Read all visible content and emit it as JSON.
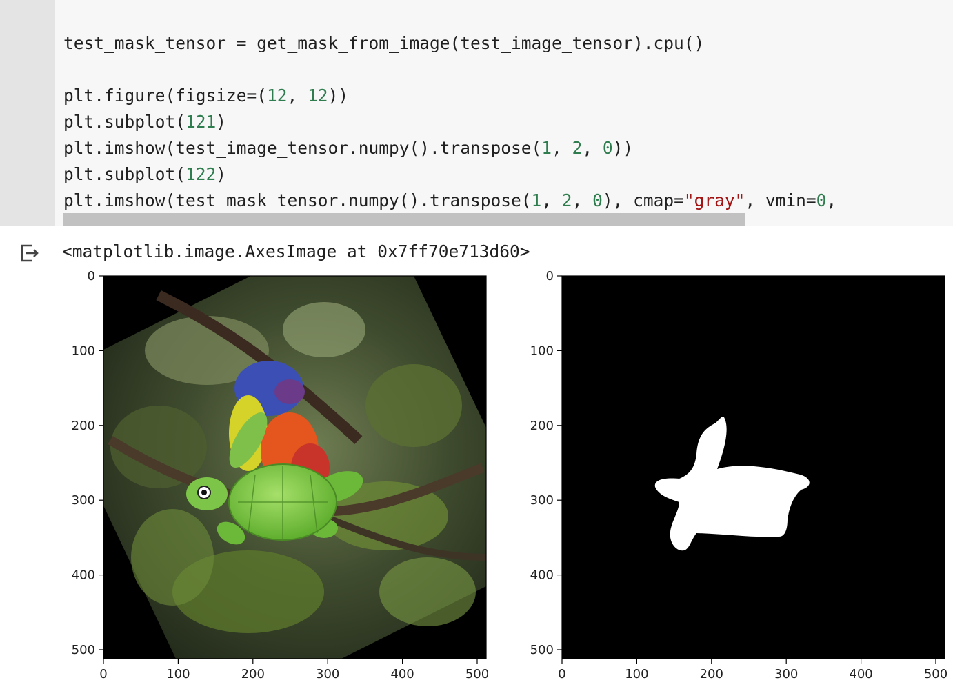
{
  "code": {
    "lines": [
      [
        {
          "t": "test_mask_tensor = get_mask_from_image(test_image_tensor).cpu()",
          "k": ""
        }
      ],
      [],
      [
        {
          "t": "plt.figure(figsize=(",
          "k": ""
        },
        {
          "t": "12",
          "k": "num"
        },
        {
          "t": ", ",
          "k": ""
        },
        {
          "t": "12",
          "k": "num"
        },
        {
          "t": "))",
          "k": ""
        }
      ],
      [
        {
          "t": "plt.subplot(",
          "k": ""
        },
        {
          "t": "121",
          "k": "num"
        },
        {
          "t": ")",
          "k": ""
        }
      ],
      [
        {
          "t": "plt.imshow(test_image_tensor.numpy().transpose(",
          "k": ""
        },
        {
          "t": "1",
          "k": "num"
        },
        {
          "t": ", ",
          "k": ""
        },
        {
          "t": "2",
          "k": "num"
        },
        {
          "t": ", ",
          "k": ""
        },
        {
          "t": "0",
          "k": "num"
        },
        {
          "t": "))",
          "k": ""
        }
      ],
      [
        {
          "t": "plt.subplot(",
          "k": ""
        },
        {
          "t": "122",
          "k": "num"
        },
        {
          "t": ")",
          "k": ""
        }
      ],
      [
        {
          "t": "plt.imshow(test_mask_tensor.numpy().transpose(",
          "k": ""
        },
        {
          "t": "1",
          "k": "num"
        },
        {
          "t": ", ",
          "k": ""
        },
        {
          "t": "2",
          "k": "num"
        },
        {
          "t": ", ",
          "k": ""
        },
        {
          "t": "0",
          "k": "num"
        },
        {
          "t": "), cmap=",
          "k": ""
        },
        {
          "t": "\"gray\"",
          "k": "str"
        },
        {
          "t": ", vmin=",
          "k": ""
        },
        {
          "t": "0",
          "k": "num"
        },
        {
          "t": ",",
          "k": ""
        }
      ]
    ]
  },
  "output": {
    "text": "<matplotlib.image.AxesImage at 0x7ff70e713d60>",
    "icon": "output-redirect-icon"
  },
  "plots": {
    "ticks": [
      "0",
      "100",
      "200",
      "300",
      "400",
      "500"
    ],
    "tick_values": [
      0,
      100,
      200,
      300,
      400,
      500
    ],
    "extent": 512,
    "left_subplot": {
      "content": "rotated photo of a parrot on branches with a cartoon turtle sticker"
    },
    "right_subplot": {
      "content": "binary turtle mask, white on black",
      "cmap": "gray"
    }
  }
}
